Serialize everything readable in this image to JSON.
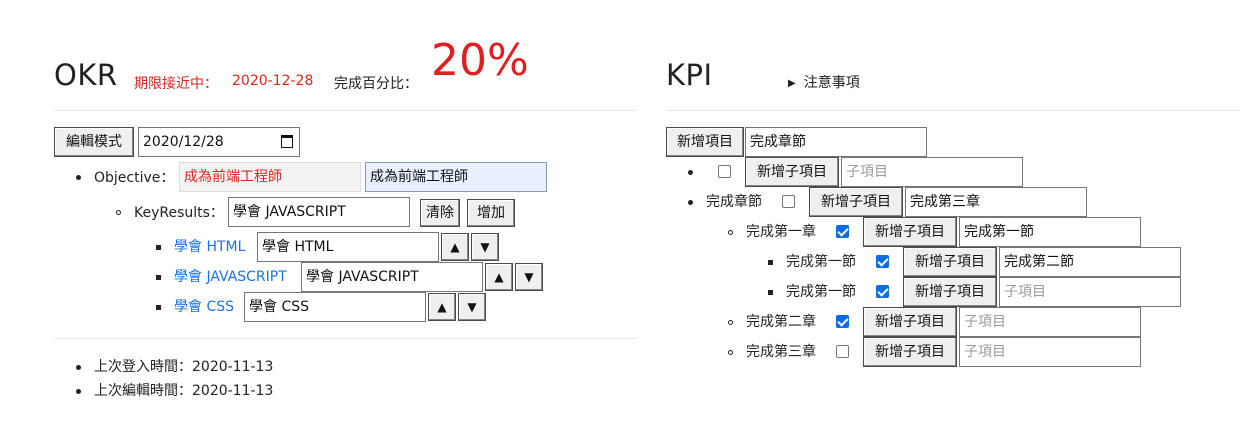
{
  "okr": {
    "title": "OKR",
    "deadline_label": "期限接近中：",
    "deadline_value": "2020-12-28",
    "progress_label": "完成百分比：",
    "progress_value": "20%",
    "edit_button": "編輯模式",
    "date_value": "2020/12/28",
    "objective_label": "Objective：",
    "objective_display": "成為前端工程師",
    "objective_input": "成為前端工程師",
    "keyresults_label": "KeyResults：",
    "keyresult_input": "學會 JAVASCRIPT",
    "clear_button": "清除",
    "add_button": "增加",
    "up_arrow": "▲",
    "down_arrow": "▼",
    "items": [
      {
        "label": "學會 HTML",
        "value": "學會 HTML"
      },
      {
        "label": "學會 JAVASCRIPT",
        "value": "學會 JAVASCRIPT"
      },
      {
        "label": "學會 CSS",
        "value": "學會 CSS"
      }
    ],
    "last_login": "上次登入時間：2020-11-13",
    "last_edit": "上次編輯時間：2020-11-13"
  },
  "kpi": {
    "title": "KPI",
    "notes_label": "注意事項",
    "add_item_button": "新增項目",
    "add_item_input": "完成章節",
    "add_sub_button": "新增子項目",
    "sub_placeholder": "子項目",
    "rows": [
      {
        "label": "",
        "checked": false,
        "input": ""
      },
      {
        "label": "完成章節",
        "checked": false,
        "input": "完成第三章"
      },
      {
        "label": "完成第一章",
        "checked": true,
        "input": "完成第一節"
      },
      {
        "label": "完成第一節",
        "checked": true,
        "input": "完成第二節"
      },
      {
        "label": "完成第一節",
        "checked": true,
        "input": ""
      },
      {
        "label": "完成第二章",
        "checked": true,
        "input": ""
      },
      {
        "label": "完成第三章",
        "checked": false,
        "input": ""
      }
    ]
  }
}
